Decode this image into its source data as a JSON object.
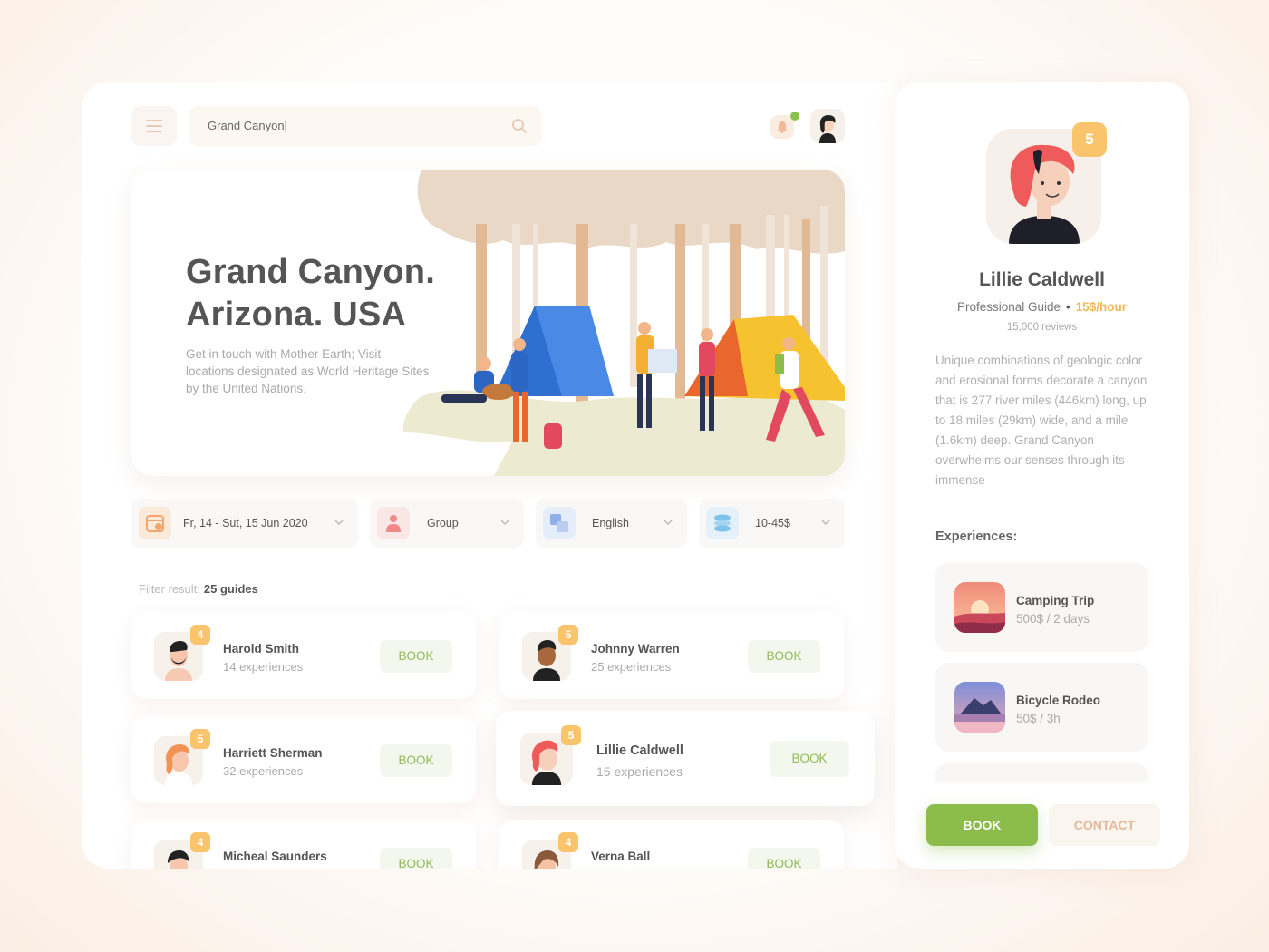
{
  "search": {
    "value": "Grand Canyon|"
  },
  "hero": {
    "title_line1": "Grand Canyon.",
    "title_line2": "Arizona. USA",
    "description": "Get in touch with Mother Earth; Visit locations designated as World Heritage Sites by the United Nations."
  },
  "filters": [
    {
      "label": "Fr, 14 - Sut, 15 Jun 2020",
      "icon": "calendar-icon"
    },
    {
      "label": "Group",
      "icon": "group-icon"
    },
    {
      "label": "English",
      "icon": "translate-icon"
    },
    {
      "label": "10-45$",
      "icon": "coins-icon"
    }
  ],
  "filter_result": {
    "label": "Filter result:",
    "value": "25 guides"
  },
  "book_label": "BOOK",
  "guides": [
    {
      "name": "Harold Smith",
      "experiences": "14 experiences",
      "rating": "4"
    },
    {
      "name": "Johnny Warren",
      "experiences": "25 experiences",
      "rating": "5"
    },
    {
      "name": "Harriett Sherman",
      "experiences": "32 experiences",
      "rating": "5"
    },
    {
      "name": "Lillie Caldwell",
      "experiences": "15 experiences",
      "rating": "5"
    },
    {
      "name": "Micheal Saunders",
      "experiences": "",
      "rating": "4"
    },
    {
      "name": "Verna Ball",
      "experiences": "",
      "rating": "4"
    }
  ],
  "profile": {
    "rating": "5",
    "name": "Lillie Caldwell",
    "role": "Professional Guide",
    "separator": "•",
    "rate": "15$/hour",
    "reviews": "15,000 reviews",
    "description": "Unique combinations of geologic color and erosional forms decorate a canyon that is 277 river miles (446km) long, up to 18 miles (29km) wide, and a mile (1.6km) deep. Grand Canyon overwhelms our senses through its immense",
    "experiences_heading": "Experiences:",
    "experiences": [
      {
        "title": "Camping Trip",
        "detail": "500$ / 2 days"
      },
      {
        "title": "Bicycle Rodeo",
        "detail": "50$ / 3h"
      }
    ],
    "book_button": "BOOK",
    "contact_button": "CONTACT"
  },
  "colors": {
    "accent_green": "#8bbc4c",
    "badge_yellow": "#f9c46b",
    "rate_orange": "#f2b75a"
  }
}
